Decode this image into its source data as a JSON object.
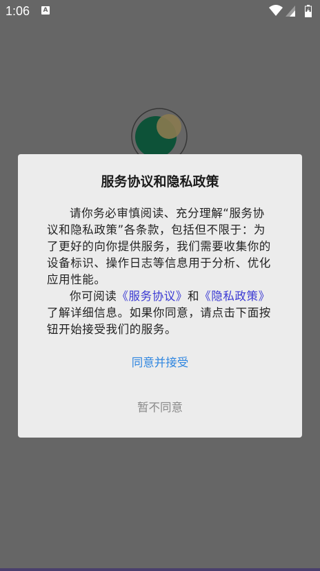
{
  "status_bar": {
    "time": "1:06",
    "notification_badge": "A",
    "icons": [
      "wifi-icon",
      "cellular-signal-icon",
      "battery-icon"
    ]
  },
  "splash": {
    "icon": "app-logo-icon",
    "ring_color": "#2a2a2a",
    "logo_color": "#0d5238",
    "accent_color": "#8a7a50"
  },
  "dialog": {
    "title": "服务协议和隐私政策",
    "paragraph1": "请你务必审慎阅读、充分理解“服务协议和隐私政策”各条款，包括但不限于：为了更好的向你提供服务，我们需要收集你的设备标识、操作日志等信息用于分析、优化应用性能。",
    "paragraph2_prefix": "你可阅读",
    "service_agreement_link": "《服务协议》",
    "paragraph2_and": "和",
    "privacy_policy_link": "《隐私政策》",
    "paragraph2_suffix": "了解详细信息。如果你同意，请点击下面按钮开始接受我们的服务。",
    "accept_label": "同意并接受",
    "decline_label": "暂不同意"
  },
  "colors": {
    "overlay": "#666666",
    "dialog_bg": "#ececec",
    "link": "#3a39d3",
    "accept": "#2f86e0",
    "decline": "#8a8a8a"
  }
}
